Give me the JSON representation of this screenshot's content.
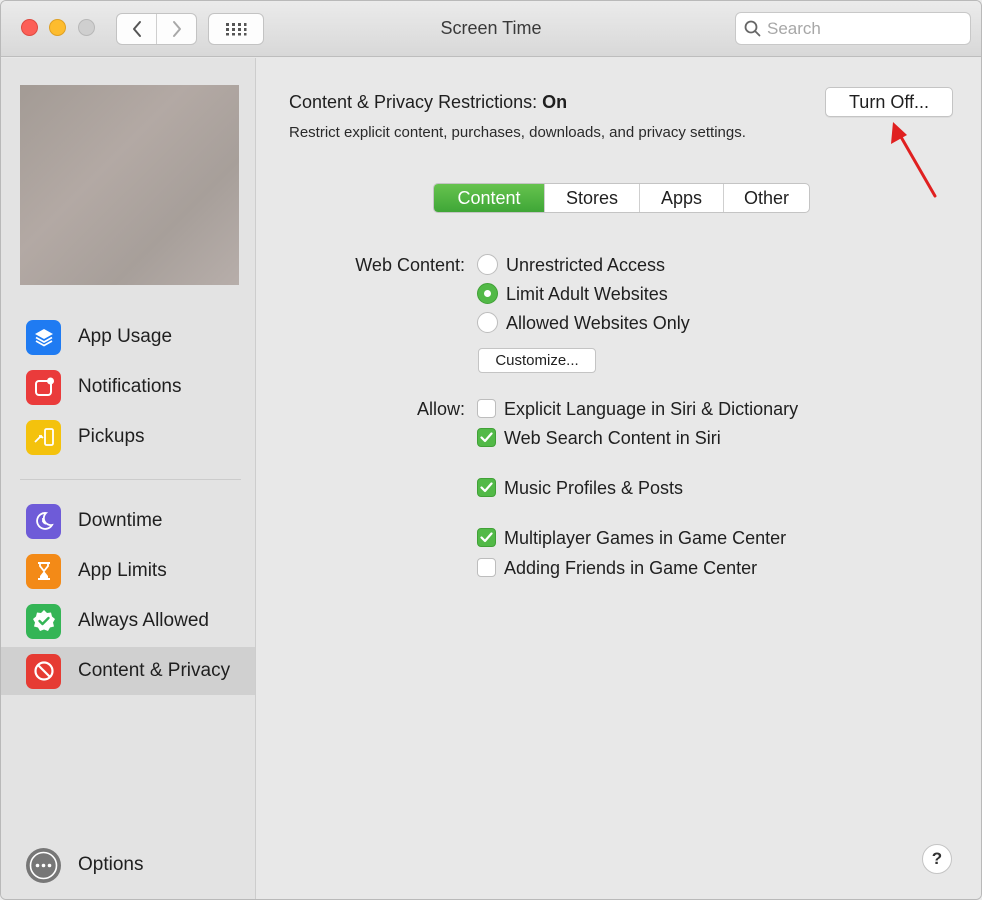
{
  "window": {
    "title": "Screen Time",
    "search": {
      "placeholder": "Search"
    }
  },
  "sidebar": {
    "items": [
      {
        "label": "App Usage",
        "icon": "layers-icon",
        "color": "#1f7bf2"
      },
      {
        "label": "Notifications",
        "icon": "notification-badge-icon",
        "color": "#ea3b3b"
      },
      {
        "label": "Pickups",
        "icon": "pickup-phone-icon",
        "color": "#f4c20d"
      },
      {
        "label": "Downtime",
        "icon": "moon-clock-icon",
        "color": "#6e5bd8"
      },
      {
        "label": "App Limits",
        "icon": "hourglass-icon",
        "color": "#f38a17"
      },
      {
        "label": "Always Allowed",
        "icon": "check-badge-icon",
        "color": "#34b556"
      },
      {
        "label": "Content & Privacy",
        "icon": "prohibit-icon",
        "color": "#e63b33",
        "selected": true
      }
    ],
    "options_label": "Options"
  },
  "main": {
    "restrictions_label": "Content & Privacy Restrictions:",
    "restrictions_status": "On",
    "subtitle": "Restrict explicit content, purchases, downloads, and privacy settings.",
    "turn_off_button": "Turn Off...",
    "tabs": [
      {
        "label": "Content",
        "active": true
      },
      {
        "label": "Stores"
      },
      {
        "label": "Apps"
      },
      {
        "label": "Other"
      }
    ],
    "web_content": {
      "label": "Web Content:",
      "options": [
        {
          "label": "Unrestricted Access",
          "selected": false
        },
        {
          "label": "Limit Adult Websites",
          "selected": true
        },
        {
          "label": "Allowed Websites Only",
          "selected": false
        }
      ],
      "customize_button": "Customize..."
    },
    "allow": {
      "label": "Allow:",
      "options": [
        {
          "label": "Explicit Language in Siri & Dictionary",
          "checked": false
        },
        {
          "label": "Web Search Content in Siri",
          "checked": true
        },
        {
          "label": "Music Profiles & Posts",
          "checked": true
        },
        {
          "label": "Multiplayer Games in Game Center",
          "checked": true
        },
        {
          "label": "Adding Friends in Game Center",
          "checked": false
        }
      ]
    },
    "help_label": "?"
  },
  "colors": {
    "accent_green": "#52b947",
    "annotation_arrow": "#e02020"
  }
}
